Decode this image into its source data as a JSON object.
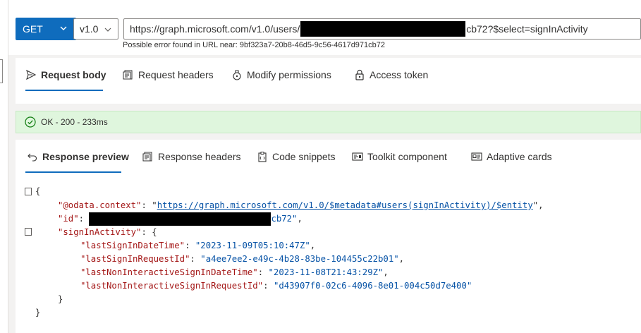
{
  "request": {
    "method": "GET",
    "version": "v1.0",
    "url_prefix": "https://graph.microsoft.com/v1.0/users/",
    "url_suffix": "cb72?$select=signInActivity",
    "url_error": "Possible error found in URL near: 9bf323a7-20b8-46d5-9c56-4617d971cb72"
  },
  "request_tabs": [
    {
      "label": "Request body",
      "icon": "send-icon"
    },
    {
      "label": "Request headers",
      "icon": "headers-icon"
    },
    {
      "label": "Modify permissions",
      "icon": "permissions-icon"
    },
    {
      "label": "Access token",
      "icon": "lock-icon"
    }
  ],
  "status": {
    "text": "OK - 200 - 233ms",
    "color": "#dff6dd",
    "icon": "checkmark-circle-icon"
  },
  "response_tabs": [
    {
      "label": "Response preview",
      "icon": "undo-arrow-icon"
    },
    {
      "label": "Response headers",
      "icon": "headers-icon"
    },
    {
      "label": "Code snippets",
      "icon": "clipboard-icon"
    },
    {
      "label": "Toolkit component",
      "icon": "toolkit-icon"
    },
    {
      "label": "Adaptive cards",
      "icon": "card-icon"
    }
  ],
  "response": {
    "odata_context_key": "\"@odata.context\"",
    "odata_context_value": "https://graph.microsoft.com/v1.0/$metadata#users(signInActivity)/$entity",
    "id_key": "\"id\"",
    "id_suffix": "cb72\"",
    "signin_key": "\"signInActivity\"",
    "fields": [
      {
        "key": "\"lastSignInDateTime\"",
        "value": "\"2023-11-09T05:10:47Z\""
      },
      {
        "key": "\"lastSignInRequestId\"",
        "value": "\"a4ee7ee2-e49c-4b28-83be-104455c22b01\""
      },
      {
        "key": "\"lastNonInteractiveSignInDateTime\"",
        "value": "\"2023-11-08T21:43:29Z\""
      },
      {
        "key": "\"lastNonInteractiveSignInRequestId\"",
        "value": "\"d43907f0-02c6-4096-8e01-004c50d7e400\""
      }
    ]
  },
  "colors": {
    "accent": "#0f6cbd",
    "json_key": "#a31515",
    "json_string": "#0451a5"
  }
}
